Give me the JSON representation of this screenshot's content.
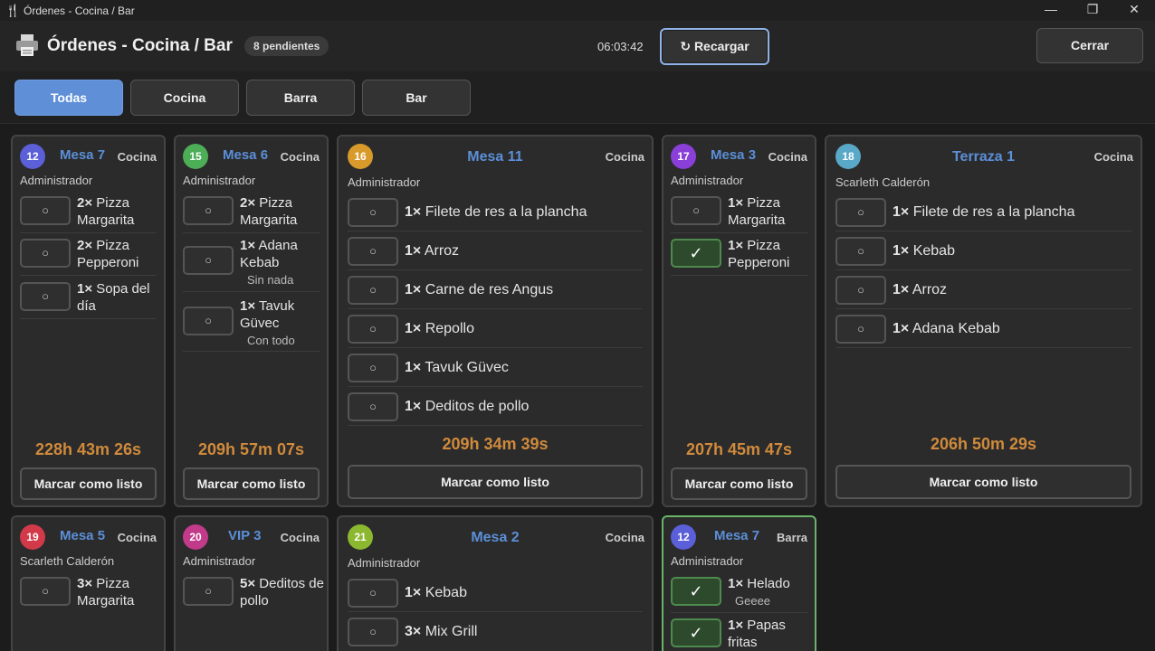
{
  "window": {
    "title": "Órdenes - Cocina / Bar",
    "app_icon": "fork-knife-icon",
    "minimize": "—",
    "restore": "❐",
    "close": "✕"
  },
  "header": {
    "title": "Órdenes - Cocina / Bar",
    "pending": "8 pendientes",
    "clock": "06:03:42",
    "reload_label": "↻ Recargar",
    "close_label": "Cerrar",
    "icon": "printer-icon"
  },
  "filters": [
    "Todas",
    "Cocina",
    "Barra",
    "Bar"
  ],
  "colors": {
    "accent": "#5b8fd8",
    "timer": "#d08a3c",
    "done": "#4e8a4e"
  },
  "ready_label": "Marcar como listo",
  "unchecked": "○",
  "checked": "✓",
  "orders": [
    {
      "num": "12",
      "num_color": "#5b5fd8",
      "table": "Mesa 7",
      "area": "Cocina",
      "waiter": "Administrador",
      "timer": "228h 43m 26s",
      "items": [
        {
          "qty": "2×",
          "name": "Pizza Margarita"
        },
        {
          "qty": "2×",
          "name": "Pizza Pepperoni"
        },
        {
          "qty": "1×",
          "name": "Sopa del día"
        }
      ]
    },
    {
      "num": "15",
      "num_color": "#4cae56",
      "table": "Mesa 6",
      "area": "Cocina",
      "waiter": "Administrador",
      "timer": "209h 57m 07s",
      "items": [
        {
          "qty": "2×",
          "name": "Pizza Margarita"
        },
        {
          "qty": "1×",
          "name": "Adana Kebab",
          "note": "Sin nada"
        },
        {
          "qty": "1×",
          "name": "Tavuk Güvec",
          "note": "Con todo"
        }
      ]
    },
    {
      "num": "16",
      "num_color": "#d89a2a",
      "table": "Mesa 11",
      "area": "Cocina",
      "waiter": "Administrador",
      "timer": "209h 34m 39s",
      "items": [
        {
          "qty": "1×",
          "name": "Filete de res a la plancha"
        },
        {
          "qty": "1×",
          "name": "Arroz"
        },
        {
          "qty": "1×",
          "name": "Carne de res Angus"
        },
        {
          "qty": "1×",
          "name": "Repollo"
        },
        {
          "qty": "1×",
          "name": "Tavuk Güvec"
        },
        {
          "qty": "1×",
          "name": "Deditos de pollo"
        }
      ]
    },
    {
      "num": "17",
      "num_color": "#8a3fd8",
      "table": "Mesa 3",
      "area": "Cocina",
      "waiter": "Administrador",
      "timer": "207h 45m 47s",
      "items": [
        {
          "qty": "1×",
          "name": "Pizza Margarita"
        },
        {
          "qty": "1×",
          "name": "Pizza Pepperoni",
          "done": true
        }
      ]
    },
    {
      "num": "18",
      "num_color": "#5aa8c8",
      "table": "Terraza 1",
      "area": "Cocina",
      "waiter": "Scarleth Calderón",
      "timer": "206h 50m 29s",
      "items": [
        {
          "qty": "1×",
          "name": "Filete de res a la plancha"
        },
        {
          "qty": "1×",
          "name": "Kebab"
        },
        {
          "qty": "1×",
          "name": "Arroz"
        },
        {
          "qty": "1×",
          "name": "Adana Kebab"
        }
      ]
    },
    {
      "num": "19",
      "num_color": "#d23a4a",
      "table": "Mesa 5",
      "area": "Cocina",
      "waiter": "Scarleth Calderón",
      "items": [
        {
          "qty": "3×",
          "name": "Pizza Margarita"
        }
      ]
    },
    {
      "num": "20",
      "num_color": "#c23a8a",
      "table": "VIP 3",
      "area": "Cocina",
      "waiter": "Administrador",
      "items": [
        {
          "qty": "5×",
          "name": "Deditos de pollo"
        }
      ]
    },
    {
      "num": "21",
      "num_color": "#8cb830",
      "table": "Mesa 2",
      "area": "Cocina",
      "waiter": "Administrador",
      "items": [
        {
          "qty": "1×",
          "name": "Kebab"
        },
        {
          "qty": "3×",
          "name": "Mix Grill"
        }
      ]
    },
    {
      "num": "12",
      "num_color": "#5b5fd8",
      "table": "Mesa 7",
      "area": "Barra",
      "waiter": "Administrador",
      "items": [
        {
          "qty": "1×",
          "name": "Helado",
          "note": "Geeee",
          "done": true
        },
        {
          "qty": "1×",
          "name": "Papas fritas",
          "done": true
        }
      ]
    }
  ]
}
